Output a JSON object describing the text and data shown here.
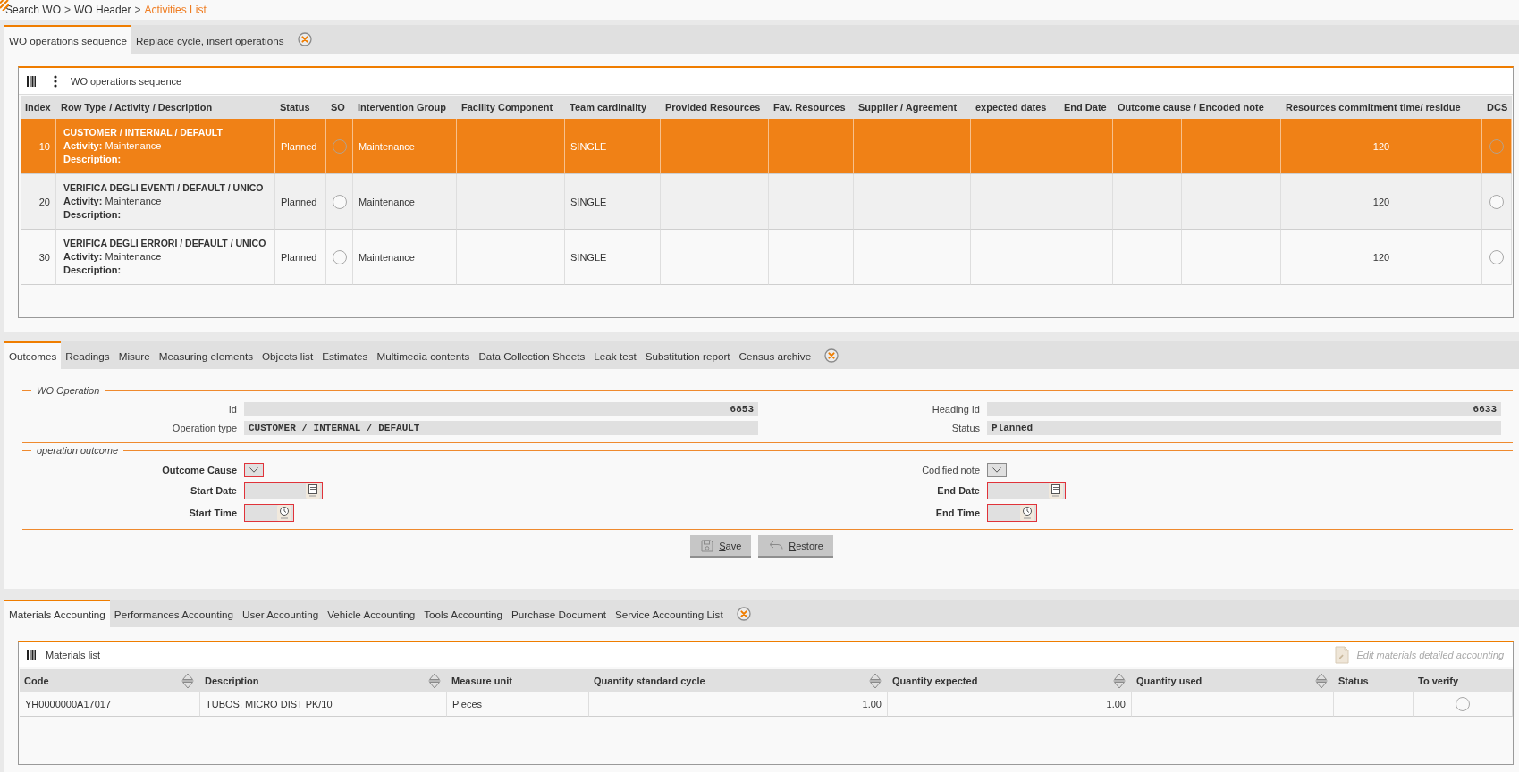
{
  "breadcrumb": {
    "separator": ">",
    "items": [
      {
        "label": "Search WO",
        "selected": false
      },
      {
        "label": "WO Header",
        "selected": false
      },
      {
        "label": "Activities List",
        "selected": true
      }
    ]
  },
  "operations_section": {
    "tabs": [
      {
        "label": "WO operations sequence",
        "selected": true
      },
      {
        "label": "Replace cycle, insert operations",
        "selected": false
      }
    ],
    "panel": {
      "title": "WO operations sequence",
      "columns": [
        "Index",
        "Row Type / Activity / Description",
        "Status",
        "SO",
        "Intervention Group",
        "Facility Component",
        "Team cardinality",
        "Provided Resources",
        "Fav. Resources",
        "Supplier / Agreement",
        "expected dates",
        "End Date",
        "Outcome cause / Encoded note",
        "Resources commitment time/ residue",
        "DCS"
      ],
      "rows": [
        {
          "selected": true,
          "index": "10",
          "row_type": "CUSTOMER / INTERNAL / DEFAULT",
          "activity": "**Activity:** Maintenance",
          "description": "Description:",
          "status": "Planned",
          "so_checked": false,
          "intervention_group": "Maintenance",
          "team_cardinality": "SINGLE",
          "resources_commitment": "120",
          "dcs_checked": false
        },
        {
          "selected": false,
          "index": "20",
          "row_type": "VERIFICA DEGLI EVENTI / DEFAULT / UNICO",
          "activity": "**Activity:** Maintenance",
          "description": "Description:",
          "status": "Planned",
          "so_checked": false,
          "intervention_group": "Maintenance",
          "team_cardinality": "SINGLE",
          "resources_commitment": "120",
          "dcs_checked": false
        },
        {
          "selected": false,
          "index": "30",
          "row_type": "VERIFICA DEGLI ERRORI / DEFAULT / UNICO",
          "activity": "**Activity:** Maintenance",
          "description": "Description:",
          "status": "Planned",
          "so_checked": false,
          "intervention_group": "Maintenance",
          "team_cardinality": "SINGLE",
          "resources_commitment": "120",
          "dcs_checked": false
        }
      ]
    }
  },
  "detail_section": {
    "tabs": [
      {
        "label": "Outcomes",
        "selected": true
      },
      {
        "label": "Readings",
        "selected": false
      },
      {
        "label": "Misure",
        "selected": false
      },
      {
        "label": "Measuring elements",
        "selected": false
      },
      {
        "label": "Objects list",
        "selected": false
      },
      {
        "label": "Estimates",
        "selected": false
      },
      {
        "label": "Multimedia contents",
        "selected": false
      },
      {
        "label": "Data Collection Sheets",
        "selected": false
      },
      {
        "label": "Leak test",
        "selected": false
      },
      {
        "label": "Substitution report",
        "selected": false
      },
      {
        "label": "Census archive",
        "selected": false
      }
    ],
    "wo_operation": {
      "legend": "WO Operation",
      "left": [
        {
          "label": "Id",
          "kind": "number",
          "value": "6853"
        },
        {
          "label": "Operation type",
          "kind": "text",
          "value": "CUSTOMER / INTERNAL / DEFAULT"
        }
      ],
      "right": [
        {
          "label": "Heading Id",
          "kind": "number",
          "value": "6633"
        },
        {
          "label": "Status",
          "kind": "text",
          "value": "Planned"
        }
      ]
    },
    "operation_outcome": {
      "legend": "operation outcome",
      "left": [
        {
          "label": "Outcome Cause",
          "kind": "select",
          "required": true
        },
        {
          "label": "Start Date",
          "kind": "date",
          "required": true
        },
        {
          "label": "Start Time",
          "kind": "time",
          "required": true
        }
      ],
      "right": [
        {
          "label": "Codified note",
          "kind": "select",
          "required": false
        },
        {
          "label": "End Date",
          "kind": "date",
          "required": true
        },
        {
          "label": "End Time",
          "kind": "time",
          "required": true
        }
      ]
    },
    "buttons": [
      {
        "label": "Save",
        "kind": "save"
      },
      {
        "label": "Restore",
        "kind": "restore"
      }
    ]
  },
  "accounting_section": {
    "tabs": [
      {
        "label": "Materials Accounting",
        "selected": true
      },
      {
        "label": "Performances Accounting",
        "selected": false
      },
      {
        "label": "User Accounting",
        "selected": false
      },
      {
        "label": "Vehicle Accounting",
        "selected": false
      },
      {
        "label": "Tools Accounting",
        "selected": false
      },
      {
        "label": "Purchase Document",
        "selected": false
      },
      {
        "label": "Service Accounting List",
        "selected": false
      }
    ],
    "panel": {
      "title": "Materials list",
      "action": {
        "label": "Edit materials detailed accounting",
        "disabled": true
      },
      "columns": [
        {
          "label": "Code",
          "sortable": true
        },
        {
          "label": "Description",
          "sortable": true
        },
        {
          "label": "Measure unit",
          "sortable": false
        },
        {
          "label": "Quantity standard cycle",
          "sortable": true
        },
        {
          "label": "Quantity expected",
          "sortable": true
        },
        {
          "label": "Quantity used",
          "sortable": true
        },
        {
          "label": "Status",
          "sortable": false
        },
        {
          "label": "To verify",
          "sortable": false
        }
      ],
      "rows": [
        {
          "code": "YH0000000A17017",
          "description": "TUBOS, MICRO DIST PK/10",
          "measure_unit": "Pieces",
          "quantity_standard_cycle": "1.00",
          "quantity_expected": "1.00",
          "to_verify_checked": false
        }
      ]
    }
  }
}
